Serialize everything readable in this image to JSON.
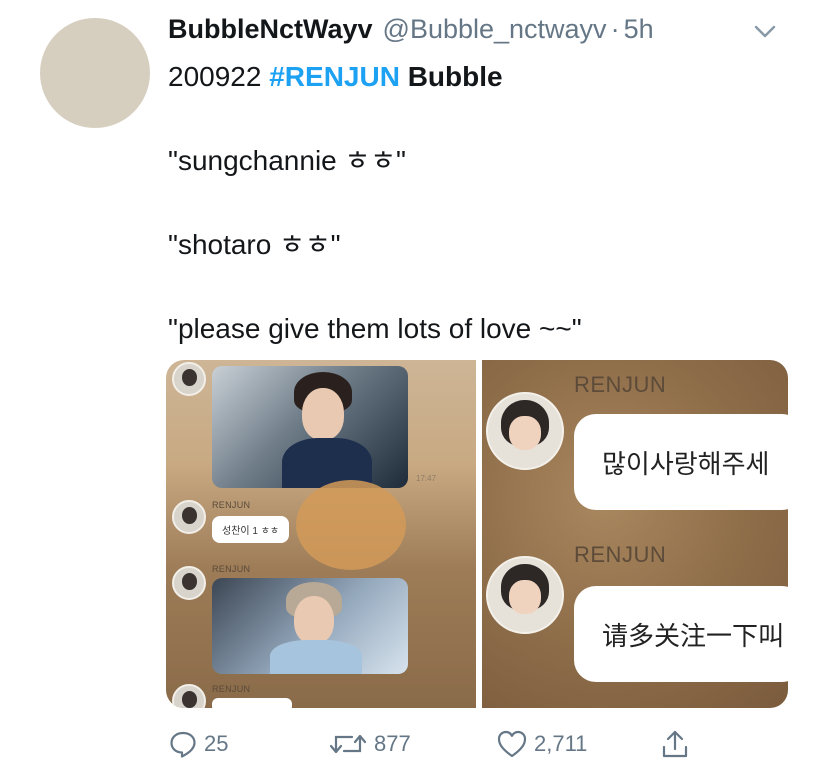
{
  "tweet": {
    "display_name": "BubbleNctWayv",
    "handle": "@Bubble_nctwayv",
    "separator": "·",
    "time": "5h",
    "line1_date": "200922",
    "line1_hashtag": "#RENJUN",
    "line1_word": "Bubble",
    "quote1": "\"sungchannie ㅎㅎ\"",
    "quote2": "\"shotaro ㅎㅎ\"",
    "quote3": "\"please give them lots of love ~~\""
  },
  "media": {
    "left_panel": {
      "name1": "RENJUN",
      "bubble1": "성찬이 1 ㅎㅎ",
      "name2": "RENJUN",
      "name3": "RENJUN",
      "timestamp": "17:47"
    },
    "right_panel": {
      "name1": "RENJUN",
      "message1": "많이사랑해주세",
      "name2": "RENJUN",
      "message2": "请多关注一下叫"
    }
  },
  "actions": {
    "reply_count": "25",
    "retweet_count": "877",
    "like_count": "2,711"
  },
  "colors": {
    "hashtag": "#1da1f2",
    "meta": "#657786",
    "text": "#14171a"
  },
  "icons": [
    "chevron-down-icon",
    "reply-icon",
    "retweet-icon",
    "like-icon",
    "share-icon"
  ]
}
